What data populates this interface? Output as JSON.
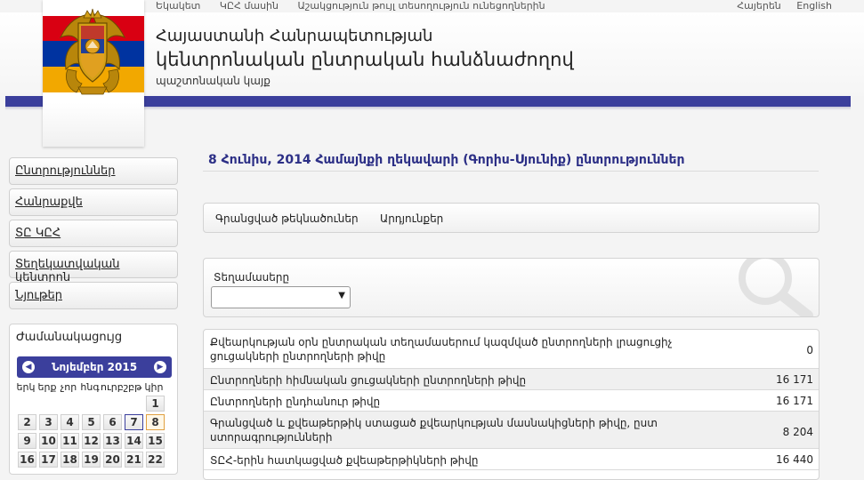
{
  "top_nav": {
    "links": [
      "Եկակետ",
      "ԿԸՀ մասին",
      "Աշակցություն թույլ տեսողություն ունեցողներին"
    ],
    "languages": [
      "Հայերեն",
      "English"
    ]
  },
  "header": {
    "title_line1": "Հայաստանի Հանրապետության",
    "title_line2": "կենտրոնական ընտրական հանձնաժողով",
    "subtitle": "պաշտոնական կայք",
    "colors": {
      "stripe": "#3b3f9c",
      "flag_red": "#d90012",
      "flag_blue": "#0033a0",
      "flag_orange": "#f2a800"
    }
  },
  "sidebar": {
    "items": [
      {
        "label": "Ընտրություններ"
      },
      {
        "label": "Հանրաքվե"
      },
      {
        "label": "ՏԸ ԿԸՀ"
      },
      {
        "label": "Տեղեկատվական կենտրոն"
      },
      {
        "label": "Նյութեր"
      }
    ]
  },
  "calendar": {
    "title": "Ժամանակացույց",
    "month_label": "Նոյեմբեր 2015",
    "weekdays": [
      "երկ",
      "երք",
      "չոր",
      "հնգ",
      "ուրբ",
      "շբթ",
      "կիր"
    ],
    "rows": [
      [
        "",
        "",
        "",
        "",
        "",
        "",
        "1"
      ],
      [
        "2",
        "3",
        "4",
        "5",
        "6",
        "7",
        "8"
      ],
      [
        "9",
        "10",
        "11",
        "12",
        "13",
        "14",
        "15"
      ],
      [
        "16",
        "17",
        "18",
        "19",
        "20",
        "21",
        "22"
      ]
    ],
    "today": "7",
    "selected": "8"
  },
  "main": {
    "page_title": "8 Հունիս, 2014 Համայնքի ղեկավարի (Գորիս-Սյունիք) ընտրություններ",
    "tabs": [
      "Գրանցված թեկնածուներ",
      "Արդյունքեր"
    ],
    "filter": {
      "label": "Տեղամասերը",
      "select_value": ""
    },
    "results": [
      {
        "label": "Քվեարկության օրն ընտրական տեղամասերում կազմված ընտրողների լրացուցիչ ցուցակների ընտրողների թիվը",
        "value": "0"
      },
      {
        "label": "Ընտրողների հիմնական ցուցակների ընտրողների թիվը",
        "value": "16 171"
      },
      {
        "label": "Ընտրողների ընդհանուր թիվը",
        "value": "16 171"
      },
      {
        "label": "Գրանցված և քվեաթերթիկ ստացած քվեարկության մասնակիցների թիվը, ըստ ստորագրությունների",
        "value": "8 204"
      },
      {
        "label": "ՏԸՀ-երին հատկացված քվեաթերթիկների թիվը",
        "value": "16 440"
      }
    ]
  }
}
